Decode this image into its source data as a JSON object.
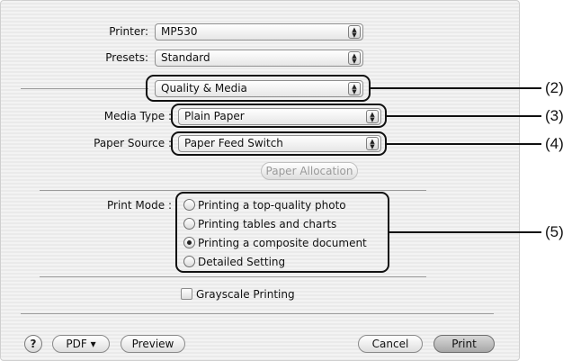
{
  "printer": {
    "label": "Printer:",
    "value": "MP530"
  },
  "presets": {
    "label": "Presets:",
    "value": "Standard"
  },
  "panel": {
    "value": "Quality & Media"
  },
  "media_type": {
    "label": "Media Type :",
    "value": "Plain Paper"
  },
  "paper_source": {
    "label": "Paper Source :",
    "value": "Paper Feed Switch"
  },
  "paper_allocation": {
    "label": "Paper Allocation"
  },
  "print_mode": {
    "label": "Print Mode :",
    "options": [
      {
        "label": "Printing a top-quality photo",
        "selected": false
      },
      {
        "label": "Printing tables and charts",
        "selected": false
      },
      {
        "label": "Printing a composite document",
        "selected": true
      },
      {
        "label": "Detailed Setting",
        "selected": false
      }
    ]
  },
  "grayscale": {
    "label": "Grayscale Printing",
    "checked": false
  },
  "footer": {
    "help": "?",
    "pdf": "PDF ▾",
    "preview": "Preview",
    "cancel": "Cancel",
    "print": "Print"
  },
  "callouts": [
    "(2)",
    "(3)",
    "(4)",
    "(5)"
  ]
}
